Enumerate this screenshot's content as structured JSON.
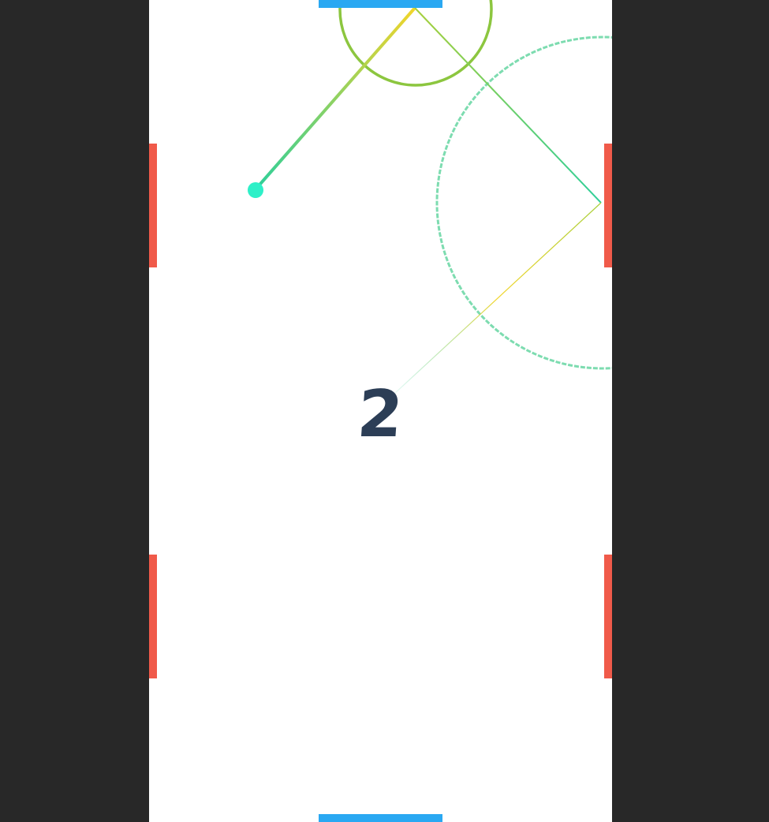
{
  "game": {
    "score": "2"
  },
  "colors": {
    "background": "#282828",
    "board": "#ffffff",
    "goal_paddle": "#2aa8f2",
    "side_paddle": "#f05a4a",
    "ball": "#2ef0c8",
    "score_text": "#2c3e56",
    "trail_start": "#f2d52a",
    "trail_end": "#2ecf9a",
    "ripple_small": "#8cc63f",
    "ripple_large": "#7ddcb0"
  },
  "icons": {
    "ball": "ball-icon"
  }
}
